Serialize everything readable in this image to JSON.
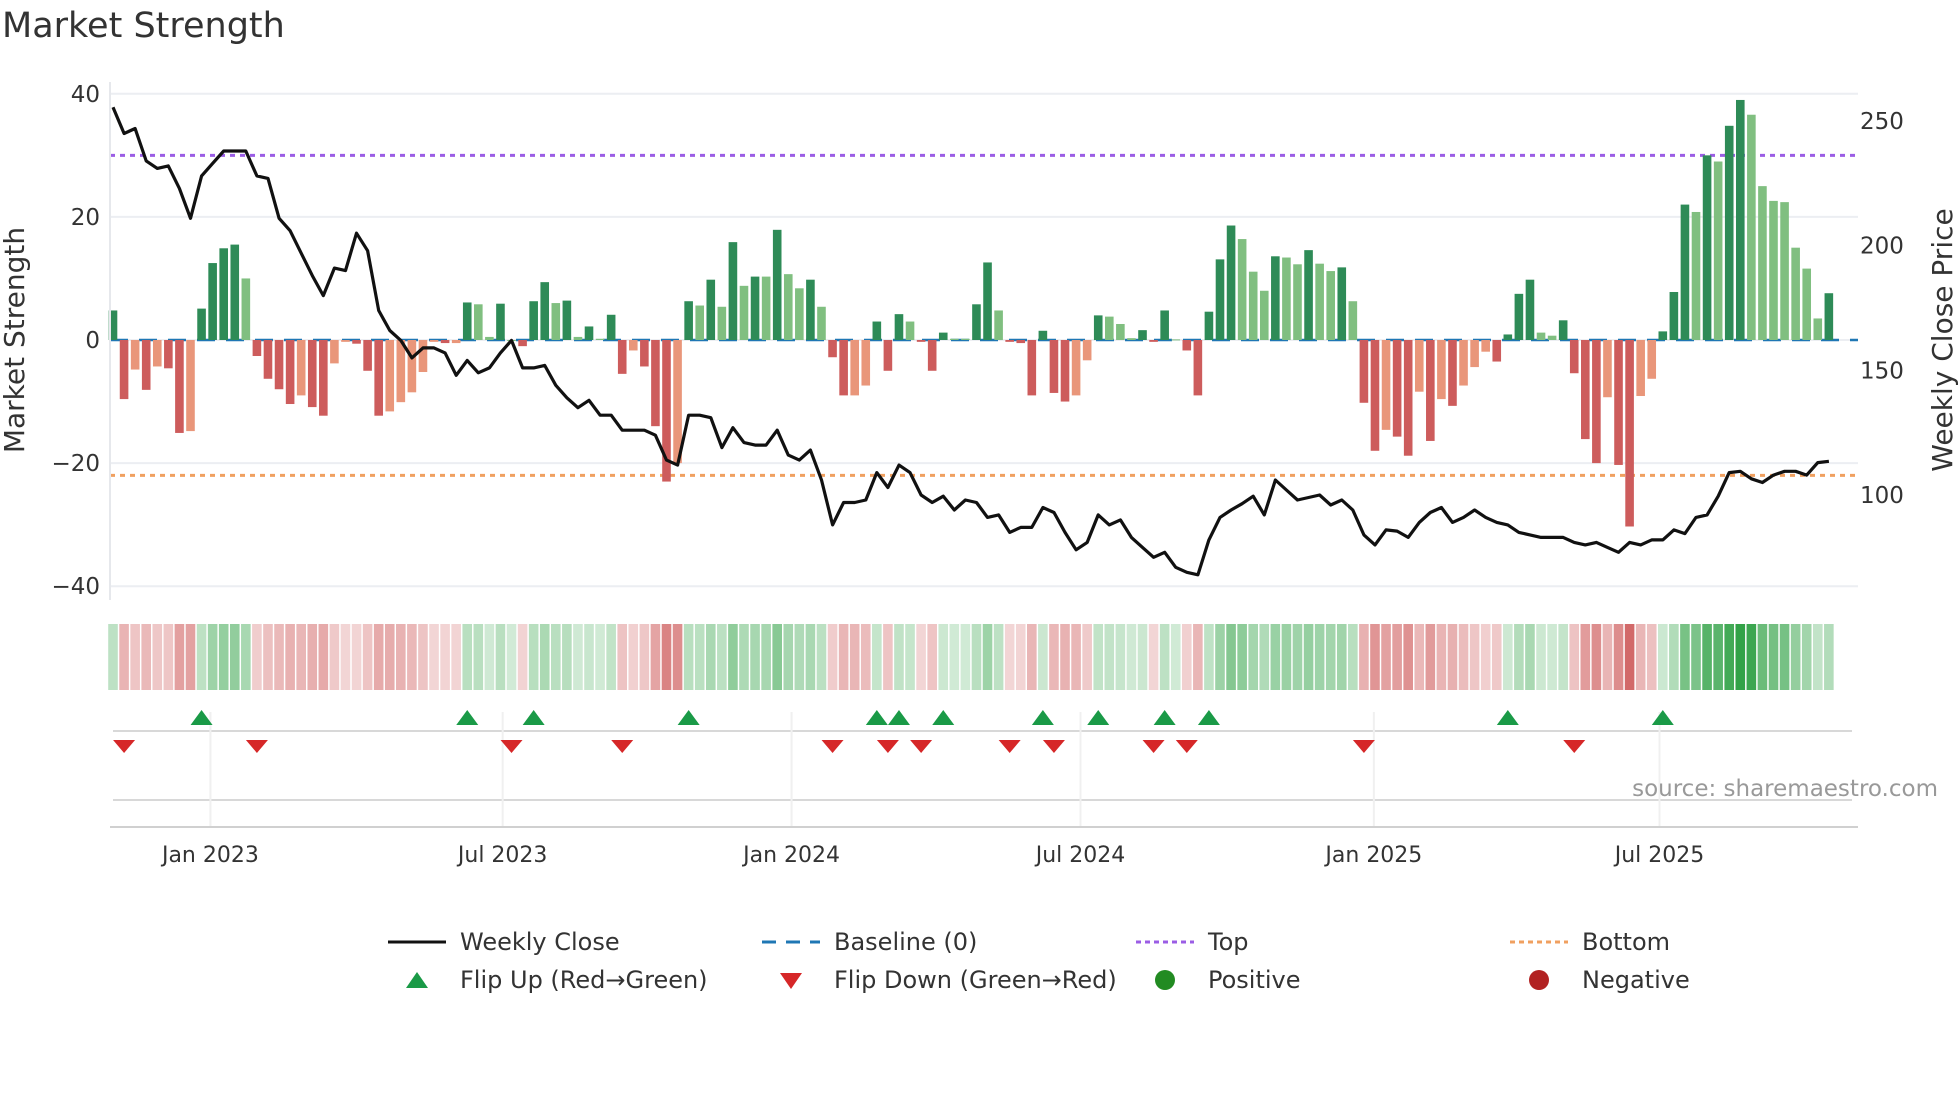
{
  "title": "Market Strength",
  "source": "source: sharemaestro.com",
  "colors": {
    "pos_strong": "#2e8b57",
    "pos_weak": "#80bf80",
    "neg_strong": "#cd5c5c",
    "neg_weak": "#e9967a",
    "close": "#111111",
    "baseline": "#1f77b4",
    "top": "#9b5de5",
    "bottom": "#f0a060",
    "flip_up": "#1a9a47",
    "flip_down": "#d62728",
    "positive": "#228b22",
    "negative": "#b22222"
  },
  "legend": [
    {
      "label": "Weekly Close",
      "icon": "solid-line"
    },
    {
      "label": "Baseline (0)",
      "icon": "dashed-line"
    },
    {
      "label": "Top",
      "icon": "dotted-line"
    },
    {
      "label": "Bottom",
      "icon": "dotted-line"
    },
    {
      "label": "Flip Up (Red→Green)",
      "icon": "triangle-up"
    },
    {
      "label": "Flip Down (Green→Red)",
      "icon": "triangle-down"
    },
    {
      "label": "Positive",
      "icon": "circle"
    },
    {
      "label": "Negative",
      "icon": "circle"
    }
  ],
  "chart_data": {
    "type": "bar",
    "title": "Market Strength",
    "ylabel": "Market Strength",
    "y2label": "Weekly Close Price",
    "ylim": [
      -42,
      42
    ],
    "y_ticks": [
      40,
      20,
      0,
      -20,
      -40
    ],
    "y_tick_labels": [
      "40",
      "20",
      "0",
      "−20",
      "−40"
    ],
    "y2_ticks": [
      100,
      150,
      200,
      250
    ],
    "y2_tick_labels": [
      "100",
      "150",
      "200",
      "250"
    ],
    "top_level": 30,
    "bottom_level": -22,
    "baseline": 0,
    "x_ticks": [
      {
        "label": "Jan 2023",
        "week": 8.8
      },
      {
        "label": "Jul 2023",
        "week": 35.2
      },
      {
        "label": "Jan 2024",
        "week": 61.3
      },
      {
        "label": "Jul 2024",
        "week": 87.4
      },
      {
        "label": "Jan 2025",
        "week": 113.9
      },
      {
        "label": "Jul 2025",
        "week": 139.7
      }
    ],
    "strength": [
      4.8,
      -9.6,
      -4.8,
      -8.1,
      -4.3,
      -4.6,
      -15.1,
      -14.8,
      5.1,
      12.5,
      14.9,
      15.5,
      10,
      -2.6,
      -6.3,
      -8,
      -10.4,
      -9,
      -10.9,
      -12.3,
      -3.8,
      -0.3,
      -0.6,
      -5,
      -12.3,
      -11.6,
      -10.1,
      -8.5,
      -5.2,
      -0.3,
      -0.5,
      -0.5,
      6.1,
      5.8,
      0.5,
      5.9,
      0,
      -1,
      6.3,
      9.4,
      6,
      6.4,
      0.5,
      2.2,
      0.2,
      4.1,
      -5.5,
      -1.7,
      -4.3,
      -14,
      -23,
      -20,
      6.3,
      5.6,
      9.8,
      5.4,
      15.9,
      8.8,
      10.3,
      10.3,
      17.9,
      10.7,
      8.4,
      9.8,
      5.4,
      -2.8,
      -9,
      -9,
      -7.4,
      3,
      -5,
      4.2,
      3,
      -0.3,
      -5,
      1.2,
      0.2,
      0.2,
      5.8,
      12.6,
      4.8,
      -0.3,
      -0.5,
      -9,
      1.5,
      -8.6,
      -10,
      -9,
      -3.3,
      4,
      3.8,
      2.6,
      0.3,
      1.6,
      -0.3,
      4.8,
      0.1,
      -1.7,
      -9,
      4.6,
      13.1,
      18.6,
      16.4,
      11.1,
      8,
      13.6,
      13.4,
      12.3,
      14.6,
      12.4,
      11.2,
      11.8,
      6.3,
      -10.2,
      -18,
      -14.6,
      -15.7,
      -18.8,
      -8.4,
      -16.4,
      -9.6,
      -10.7,
      -7.4,
      -4.4,
      -1.9,
      -3.5,
      0.9,
      7.5,
      9.8,
      1.2,
      0.7,
      3.2,
      -5.4,
      -16.1,
      -20,
      -9.3,
      -20.3,
      -30.3,
      -9.1,
      -6.3,
      1.4,
      7.8,
      22,
      20.8,
      30,
      29,
      34.8,
      39,
      36.6,
      25,
      22.6,
      22.4,
      15,
      11.6,
      3.5,
      7.6
    ],
    "weekly_close": [
      255.5,
      245,
      247,
      234,
      231,
      232,
      223,
      211,
      228,
      233,
      238,
      238,
      238,
      228,
      227,
      211,
      206,
      197,
      188,
      180,
      191,
      190,
      205,
      198,
      174,
      166,
      162,
      155,
      159,
      159,
      157,
      148,
      154,
      149,
      151,
      157,
      162,
      151,
      151,
      152,
      144,
      139,
      135,
      138,
      132,
      132,
      126,
      126,
      126,
      124,
      114,
      112,
      132,
      132,
      131,
      119,
      127,
      121,
      120,
      120,
      126,
      116,
      114,
      118,
      106,
      88,
      97,
      97,
      98,
      109,
      103,
      112,
      109,
      100,
      97,
      99.5,
      94,
      98,
      97,
      91,
      92,
      85,
      87,
      87,
      95,
      93,
      85,
      78,
      81,
      92,
      88,
      90,
      83,
      79,
      75,
      77,
      71,
      69,
      68,
      82,
      91,
      94,
      96.5,
      99.5,
      92,
      106,
      102,
      98,
      99,
      100,
      96,
      98,
      94,
      84,
      80,
      86,
      85.5,
      83,
      89,
      93,
      95,
      89,
      91,
      94,
      91,
      89,
      88,
      85,
      84,
      83,
      83,
      83,
      81,
      80,
      81,
      79,
      77,
      81,
      80,
      82,
      82,
      86,
      84.5,
      91,
      92,
      99.5,
      109,
      109.5,
      106.5,
      105,
      108,
      109.5,
      109.5,
      108,
      113,
      113.5
    ],
    "flip_up_weeks": [
      8,
      32,
      38,
      52,
      69,
      71,
      75,
      84,
      89,
      95,
      99,
      126,
      140
    ],
    "flip_down_weeks": [
      1,
      13,
      36,
      46,
      65,
      70,
      73,
      81,
      85,
      94,
      97,
      113,
      132
    ],
    "grid": true,
    "legend_position": "bottom"
  }
}
